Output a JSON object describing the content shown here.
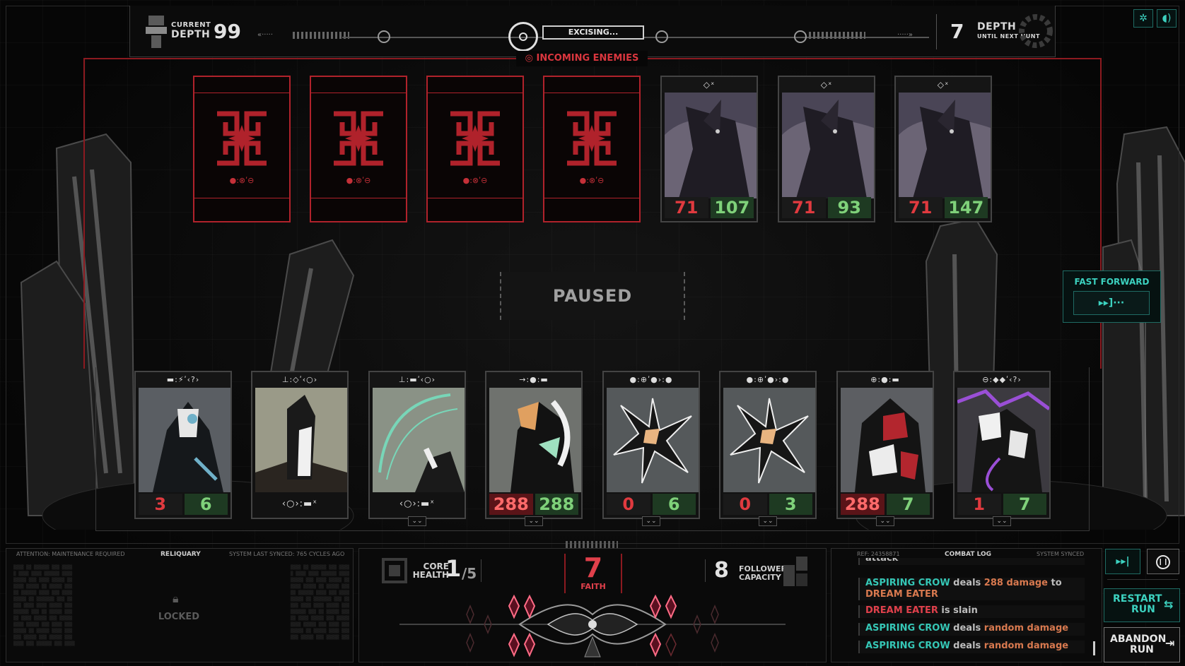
{
  "topbar": {
    "current_label_1": "CURRENT",
    "current_label_2": "DEPTH",
    "current_depth": "99",
    "status": "EXCISING...",
    "next_hunt_value": "7",
    "next_hunt_label_1": "DEPTH",
    "next_hunt_label_2": "UNTIL NEXT HUNT"
  },
  "incoming": {
    "label": "INCOMING ENEMIES",
    "hidden_cards": [
      {
        "icons": "●:⊗ʹ⊖"
      },
      {
        "icons": "●:⊗ʹ⊖"
      },
      {
        "icons": "●:⊗ʹ⊖"
      },
      {
        "icons": "●:⊗ʹ⊖"
      }
    ],
    "known_cards": [
      {
        "icons": "◇ˣ",
        "attack": "71",
        "health": "107"
      },
      {
        "icons": "◇ˣ",
        "attack": "71",
        "health": "93"
      },
      {
        "icons": "◇ˣ",
        "attack": "71",
        "health": "147"
      }
    ]
  },
  "paused": "PAUSED",
  "fast_forward": {
    "label": "FAST FORWARD",
    "button": "▸▸]···"
  },
  "followers": [
    {
      "icons": "▬:⚡ʹ‹?›",
      "attack": "3",
      "health": "6",
      "accent": "#6fb0c8"
    },
    {
      "icons": "⊥:◇ʹ‹○›",
      "ability": "‹○›:▬ˣ",
      "accent": "#c8c8c8"
    },
    {
      "icons": "⊥:▬ʹ‹○›",
      "ability": "‹○›:▬ˣ",
      "accent": "#78d6b8"
    },
    {
      "icons": "→:●:▬",
      "attack": "288",
      "health": "288",
      "accent": "#e0a060"
    },
    {
      "icons": "●:⊕ʹ●›:●",
      "attack": "0",
      "health": "6",
      "accent": "#e8b480"
    },
    {
      "icons": "●:⊕ʹ●›:●",
      "attack": "0",
      "health": "3",
      "accent": "#e8b480"
    },
    {
      "icons": "⊕:●:▬",
      "attack": "288",
      "health": "7",
      "accent": "#b3262e"
    },
    {
      "icons": "⊖:◆◆ʹ‹?›",
      "attack": "1",
      "health": "7",
      "accent": "#9a4fd6"
    }
  ],
  "reliquary": {
    "attention": "ATTENTION: MAINTENANCE REQUIRED",
    "title": "RELIQUARY",
    "synced": "SYSTEM LAST SYNCED: 765 CYCLES AGO",
    "locked": "LOCKED"
  },
  "core": {
    "health_label_1": "CORE",
    "health_label_2": "HEALTH",
    "health": "1",
    "health_max": "/5",
    "faith": "7",
    "faith_label": "FAITH",
    "capacity": "8",
    "capacity_label_1": "FOLLOWER",
    "capacity_label_2": "CAPACITY"
  },
  "combat_log": {
    "title": "COMBAT LOG",
    "ref": "REF: 24358871",
    "synced": "SYSTEM SYNCED",
    "cut_entry": "attack",
    "entries": [
      {
        "actor": "ASPIRING CROW",
        "verb": " deals ",
        "detail": "288 damage",
        "mid": " to ",
        "target": "DREAM EATER"
      },
      {
        "actor": "DREAM EATER",
        "verb": " is slain"
      },
      {
        "actor": "ASPIRING CROW",
        "verb": " deals ",
        "detail": "random damage"
      },
      {
        "actor": "ASPIRING CROW",
        "verb": " deals ",
        "detail": "random damage"
      }
    ]
  },
  "buttons": {
    "restart_1": "RESTART",
    "restart_2": "RUN",
    "abandon_1": "ABANDON",
    "abandon_2": "RUN",
    "speed_icon": "▸▸|",
    "pause_icon": "❙❙"
  }
}
